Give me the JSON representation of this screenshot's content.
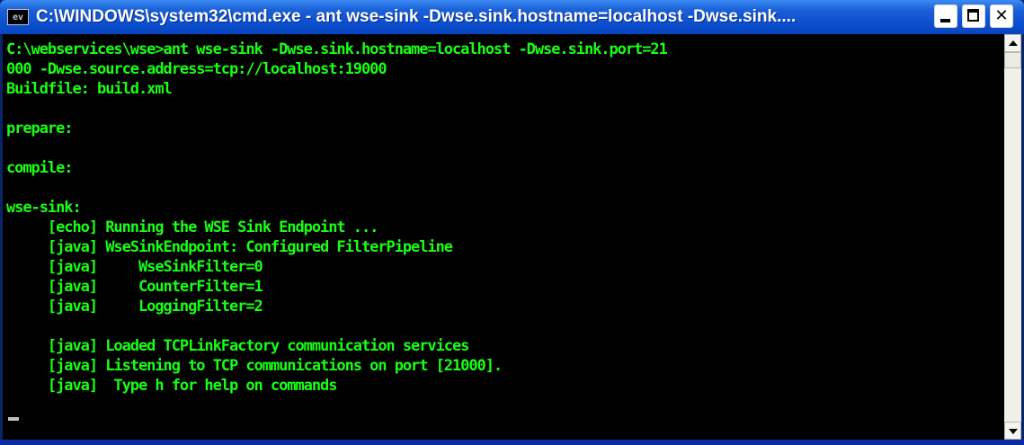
{
  "window": {
    "icon_text": "ev",
    "title": "C:\\WINDOWS\\system32\\cmd.exe - ant wse-sink -Dwse.sink.hostname=localhost -Dwse.sink....",
    "controls": {
      "minimize": "minimize",
      "maximize": "maximize",
      "close": "✕"
    }
  },
  "console": {
    "text_color": "#19ff14",
    "background": "#000000",
    "lines": [
      "C:\\webservices\\wse>ant wse-sink -Dwse.sink.hostname=localhost -Dwse.sink.port=21",
      "000 -Dwse.source.address=tcp://localhost:19000",
      "Buildfile: build.xml",
      "",
      "prepare:",
      "",
      "compile:",
      "",
      "wse-sink:",
      "     [echo] Running the WSE Sink Endpoint ...",
      "     [java] WseSinkEndpoint: Configured FilterPipeline",
      "     [java]     WseSinkFilter=0",
      "     [java]     CounterFilter=1",
      "     [java]     LoggingFilter=2",
      "",
      "     [java] Loaded TCPLinkFactory communication services",
      "     [java] Listening to TCP communications on port [21000].",
      "     [java]  Type h for help on commands"
    ]
  },
  "scrollbar": {
    "up": "scroll-up",
    "down": "scroll-down"
  }
}
